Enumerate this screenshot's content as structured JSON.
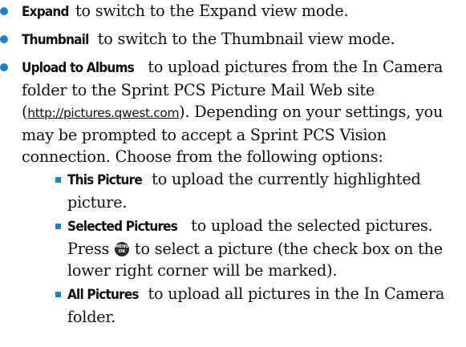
{
  "items": [
    {
      "term": "Expand",
      "text": " to switch to the Expand view mode."
    },
    {
      "term": "Thumbnail",
      "text": " to switch to the Thumbnail view mode."
    },
    {
      "term": "Upload to Albums",
      "text_before_link": " to upload pictures from the In Camera folder to the Sprint PCS Picture Mail Web site (",
      "link": "http://pictures.qwest.com",
      "text_after_link": "). Depending on your settings, you may be prompted to accept a Sprint PCS Vision connection. Choose from the following options:",
      "subitems": [
        {
          "term": "This Picture",
          "text": " to upload the currently highlighted picture."
        },
        {
          "term": "Selected Pictures",
          "text_before_key": " to upload the selected pictures. Press ",
          "key_icon": "menu-ok-key-icon",
          "key_label_top": "MENU",
          "key_label_bottom": "OK",
          "text_after_key": " to select a picture (the check box on the lower right corner will be marked)."
        },
        {
          "term": "All Pictures",
          "text": " to upload all pictures in the In Camera folder."
        }
      ]
    }
  ],
  "colors": {
    "bullet": "#1f82c8",
    "text": "#111111",
    "key": "#2b2b2b"
  }
}
